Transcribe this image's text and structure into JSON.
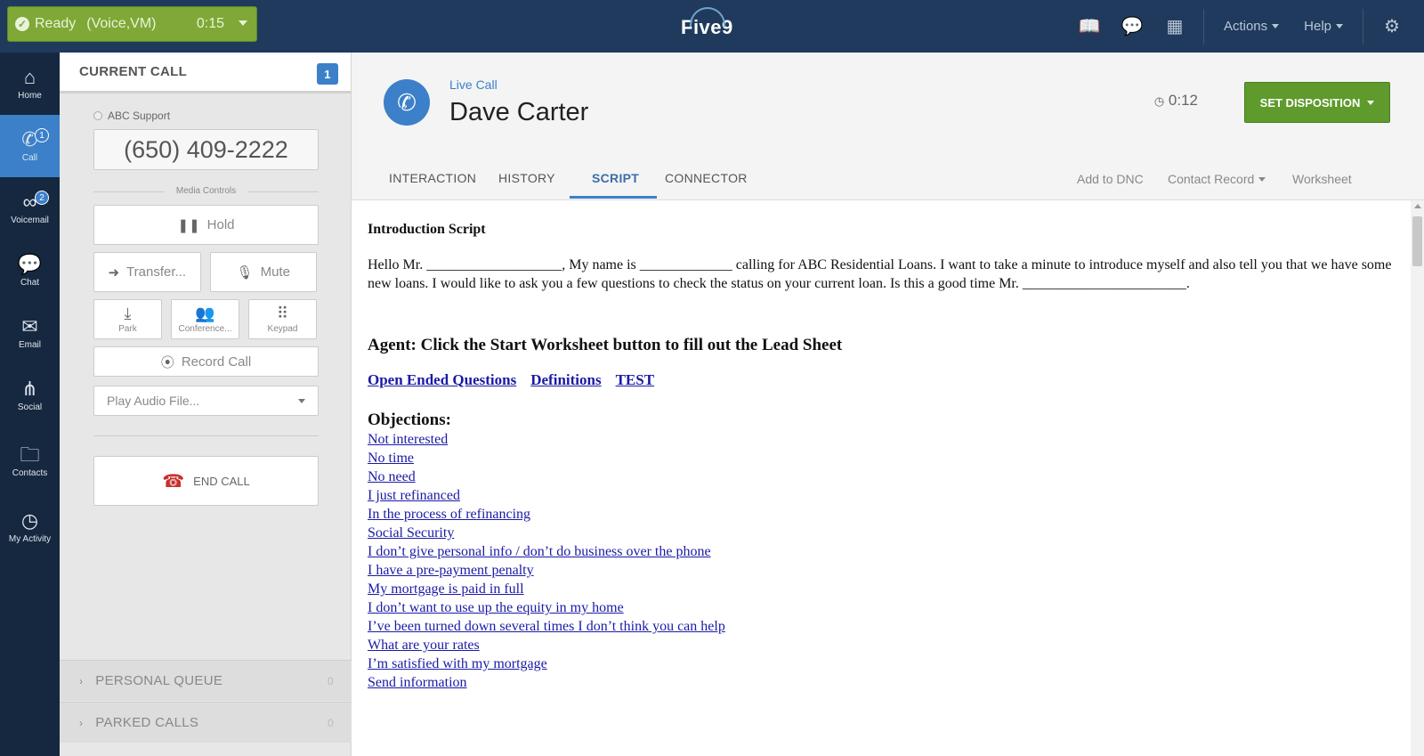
{
  "topbar": {
    "status": "Ready",
    "mode": "(Voice,VM)",
    "timer": "0:15",
    "brand": "Five9",
    "menus": [
      "Actions",
      "Help"
    ],
    "icons": [
      "book-icon",
      "chat-bubble-icon",
      "calendar-icon",
      "gear-icon"
    ]
  },
  "nav": {
    "items": [
      {
        "label": "Home",
        "icon": "home-icon"
      },
      {
        "label": "Call",
        "icon": "phone-icon",
        "badge": "1"
      },
      {
        "label": "Voicemail",
        "icon": "voicemail-icon",
        "badge": "2"
      },
      {
        "label": "Chat",
        "icon": "chat-icon"
      },
      {
        "label": "Email",
        "icon": "email-icon"
      },
      {
        "label": "Social",
        "icon": "social-icon"
      },
      {
        "label": "Contacts",
        "icon": "folder-icon"
      },
      {
        "label": "My Activity",
        "icon": "clock-icon"
      }
    ]
  },
  "callpanel": {
    "title": "CURRENT CALL",
    "count": "1",
    "queue": "ABC Support",
    "phone": "(650) 409-2222",
    "media_label": "Media Controls",
    "hold": "Hold",
    "transfer": "Transfer...",
    "mute": "Mute",
    "park": "Park",
    "conference": "Conference...",
    "keypad": "Keypad",
    "record": "Record Call",
    "play_audio": "Play Audio File...",
    "end_call": "END CALL",
    "personal_queue": "PERSONAL QUEUE",
    "personal_queue_count": "0",
    "parked_calls": "PARKED CALLS",
    "parked_calls_count": "0"
  },
  "call": {
    "live_label": "Live Call",
    "name": "Dave Carter",
    "elapsed": "0:12",
    "disposition": "SET DISPOSITION"
  },
  "tabs": [
    "INTERACTION",
    "HISTORY",
    "SCRIPT",
    "CONNECTOR"
  ],
  "right_links": [
    "Add to DNC",
    "Contact Record",
    "Worksheet"
  ],
  "script": {
    "title": "Introduction Script",
    "intro": "Hello Mr. ___________________, My name is _____________ calling for ABC Residential Loans.  I want to take a minute to introduce myself and also tell you that we have some new loans.  I would like to ask you a few questions to check the status on your current loan.  Is this a good time Mr. _______________________.",
    "agent": "Agent: Click the Start Worksheet button to fill out the Lead Sheet",
    "links": [
      "Open Ended Questions",
      "Definitions",
      "TEST"
    ],
    "objections_title": "Objections:",
    "objections": [
      "Not interested",
      "No time",
      "No need",
      "I just refinanced",
      "In the process of refinancing",
      "Social Security",
      "I don’t give personal info / don’t do business over the phone",
      "I have a pre-payment penalty",
      "My mortgage is paid in full",
      "I don’t want to use up the equity in my home",
      "I’ve been turned down several times I don’t think you can help",
      "What are your rates",
      "I’m satisfied with my mortgage",
      "Send information"
    ]
  }
}
